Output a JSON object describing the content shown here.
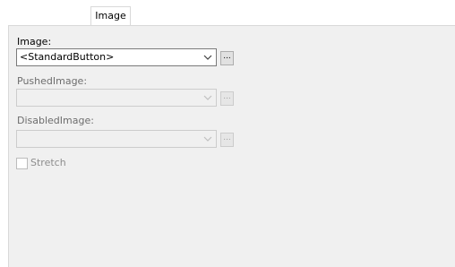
{
  "tabs": [
    {
      "label": "Image"
    }
  ],
  "image": {
    "label": "Image:",
    "value": "<StandardButton>",
    "browse_label": "..."
  },
  "pushed_image": {
    "label": "PushedImage:",
    "value": "",
    "browse_label": "..."
  },
  "disabled_image": {
    "label": "DisabledImage:",
    "value": "",
    "browse_label": "..."
  },
  "stretch": {
    "label": "Stretch",
    "checked": false
  },
  "colors": {
    "panel_background": "#f0f0f0",
    "disabled_text": "#6d6d6d",
    "border": "#7a7a7a"
  },
  "icons": {
    "dropdown": "chevron-down-icon"
  }
}
